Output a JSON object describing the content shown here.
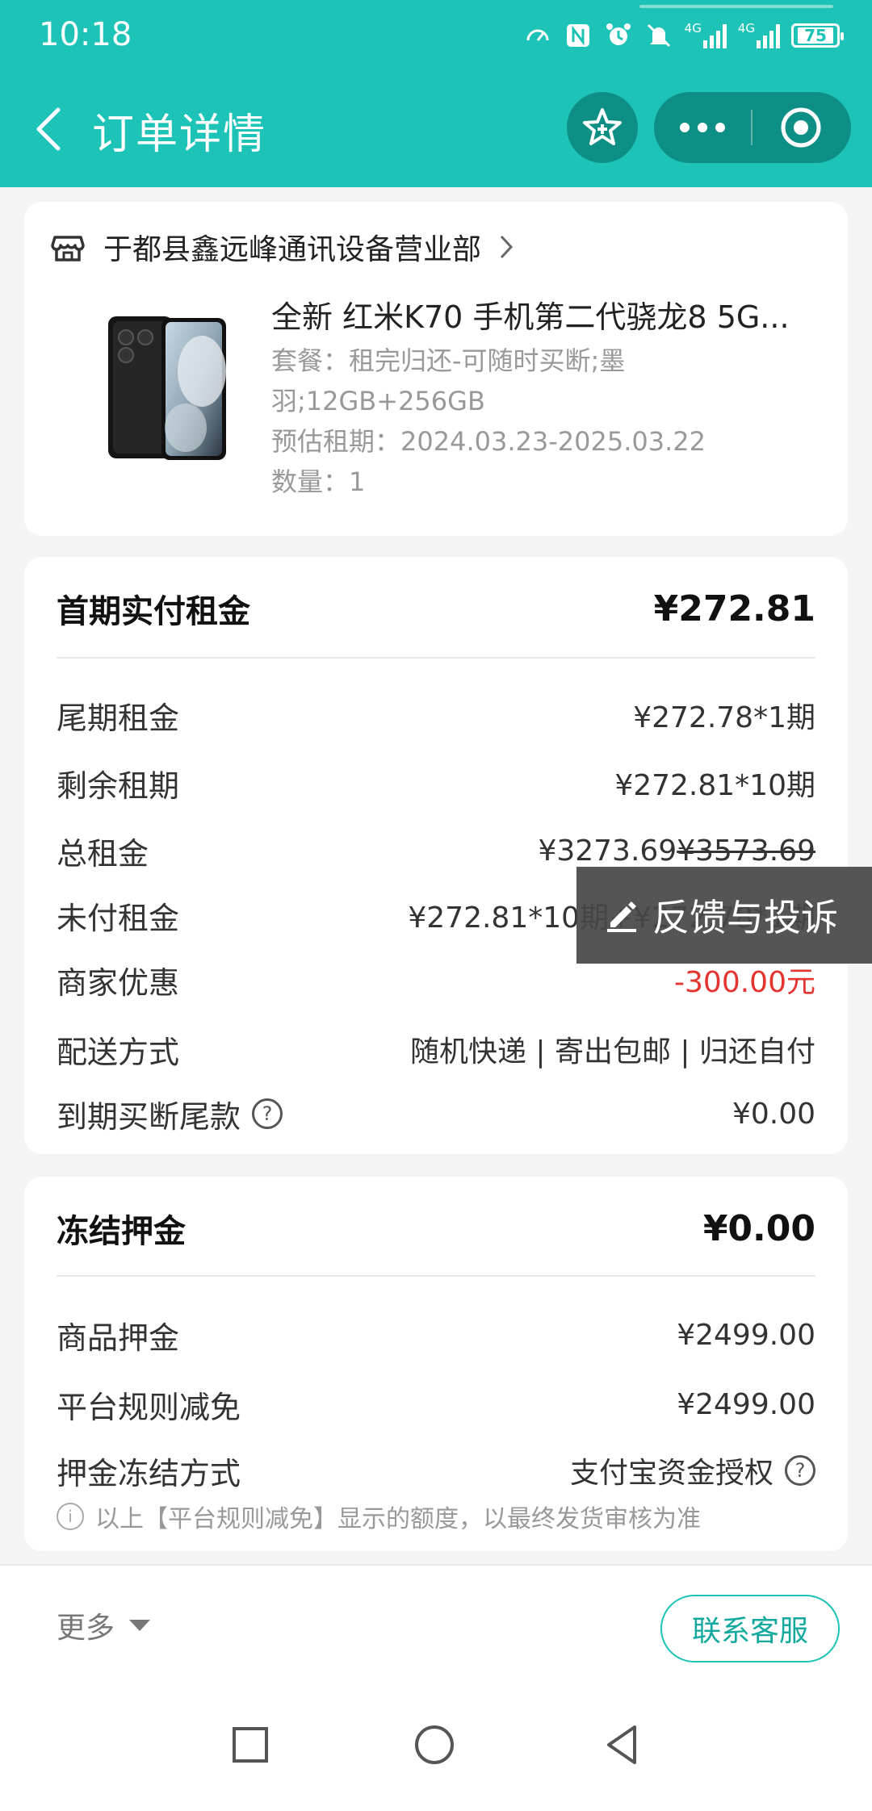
{
  "status_bar": {
    "time": "10:18",
    "network_1": "4G",
    "network_2": "4G",
    "battery": "75",
    "icons": [
      "speed-icon",
      "nfc-icon",
      "alarm-icon",
      "mute-icon",
      "signal-icon",
      "signal-icon",
      "battery-icon"
    ]
  },
  "nav": {
    "title": "订单详情",
    "back_icon": "back-chevron-icon",
    "favorite_icon": "star-plus-icon",
    "more_icon": "more-dots-icon",
    "close_icon": "target-close-icon"
  },
  "store": {
    "name": "于都县鑫远峰通讯设备营业部",
    "icon": "store-icon"
  },
  "product": {
    "title": "全新 红米K70 手机第二代骁龙8 5G...",
    "package_line1": "套餐：租完归还-可随时买断;墨",
    "package_line2": "羽;12GB+256GB",
    "period": "预估租期：2024.03.23-2025.03.22",
    "quantity": "数量：1"
  },
  "rent": {
    "head_label": "首期实付租金",
    "head_value": "¥272.81",
    "rows": [
      {
        "label": "尾期租金",
        "value": "¥272.78*1期"
      },
      {
        "label": "剩余租期",
        "value": "¥272.81*10期"
      },
      {
        "label": "总租金",
        "value": "¥3273.69",
        "value_strike": "¥3573.69"
      },
      {
        "label": "未付租金",
        "value": "¥272.81*10期+¥272.78*1期"
      },
      {
        "label": "商家优惠",
        "value": "-300.00元"
      },
      {
        "label": "配送方式",
        "value": "随机快递 | 寄出包邮 | 归还自付"
      },
      {
        "label": "到期买断尾款",
        "value": "¥0.00",
        "help": "?"
      }
    ]
  },
  "deposit": {
    "head_label": "冻结押金",
    "head_value": "¥0.00",
    "rows": [
      {
        "label": "商品押金",
        "value": "¥2499.00"
      },
      {
        "label": "平台规则减免",
        "value": "¥2499.00"
      },
      {
        "label": "押金冻结方式",
        "value": "支付宝资金授权",
        "help": "?"
      }
    ],
    "note_icon": "i",
    "note": "以上【平台规则减免】显示的额度，以最终发货审核为准"
  },
  "feedback": {
    "label": "反馈与投诉",
    "icon": "edit-pen-icon"
  },
  "bottom": {
    "more_label": "更多",
    "customer_service": "联系客服"
  },
  "colors": {
    "brand": "#1cc3b6",
    "brand_dark": "#0e8f85",
    "discount": "#e3342f"
  }
}
